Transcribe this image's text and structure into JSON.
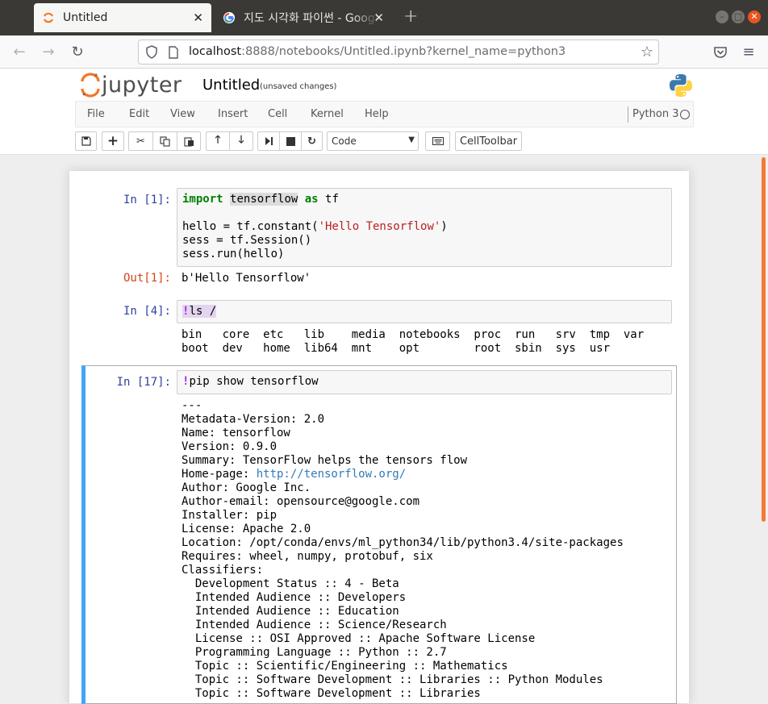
{
  "browser": {
    "tabs": [
      {
        "title": "Untitled",
        "active": true
      },
      {
        "title": "지도 시각화 파이썬 - Google 검색",
        "active": false
      }
    ],
    "url": {
      "host": "localhost",
      "rest": ":8888/notebooks/Untitled.ipynb?kernel_name=python3"
    },
    "new_tab_glyph": "+",
    "close_glyph": "✕"
  },
  "jupyter": {
    "logo_text": "jupyter",
    "notebook_title": "Untitled",
    "save_status": "(unsaved changes)",
    "menu": [
      "File",
      "Edit",
      "View",
      "Insert",
      "Cell",
      "Kernel",
      "Help"
    ],
    "kernel_name": "Python 3",
    "cell_type_select": "Code",
    "celltoolbar_label": "CellToolbar"
  },
  "cells": [
    {
      "prompt_in": "In [1]:",
      "code": [
        "import tensorflow as tf",
        "",
        "hello = tf.constant('Hello Tensorflow')",
        "sess = tf.Session()",
        "sess.run(hello)"
      ],
      "prompt_out": "Out[1]:",
      "output": "b'Hello Tensorflow'"
    },
    {
      "prompt_in": "In [4]:",
      "code": [
        "!ls /"
      ],
      "output": "bin   core  etc   lib    media  notebooks  proc  run   srv  tmp  var\nboot  dev   home  lib64  mnt    opt        root  sbin  sys  usr"
    },
    {
      "prompt_in": "In [17]:",
      "code": [
        "!pip show tensorflow"
      ],
      "output_before_link": "---\nMetadata-Version: 2.0\nName: tensorflow\nVersion: 0.9.0\nSummary: TensorFlow helps the tensors flow\nHome-page: ",
      "home_page_link": "http://tensorflow.org/",
      "output_after_link": "\nAuthor: Google Inc.\nAuthor-email: opensource@google.com\nInstaller: pip\nLicense: Apache 2.0\nLocation: /opt/conda/envs/ml_python34/lib/python3.4/site-packages\nRequires: wheel, numpy, protobuf, six\nClassifiers:\n  Development Status :: 4 - Beta\n  Intended Audience :: Developers\n  Intended Audience :: Education\n  Intended Audience :: Science/Research\n  License :: OSI Approved :: Apache Software License\n  Programming Language :: Python :: 2.7\n  Topic :: Scientific/Engineering :: Mathematics\n  Topic :: Software Development :: Libraries :: Python Modules\n  Topic :: Software Development :: Libraries"
    }
  ],
  "icons": {
    "back": "back-arrow-icon",
    "forward": "forward-arrow-icon",
    "reload": "reload-icon",
    "shield": "tracking-shield-icon",
    "page": "page-info-icon",
    "star": "bookmark-star-icon",
    "pocket": "pocket-icon",
    "menu": "hamburger-menu-icon"
  },
  "colors": {
    "jupyter_orange": "#f37726",
    "prompt_in": "#303f9f",
    "prompt_out": "#d84315",
    "selected_border": "#42a5f5",
    "ubuntu_orange": "#e95420"
  }
}
